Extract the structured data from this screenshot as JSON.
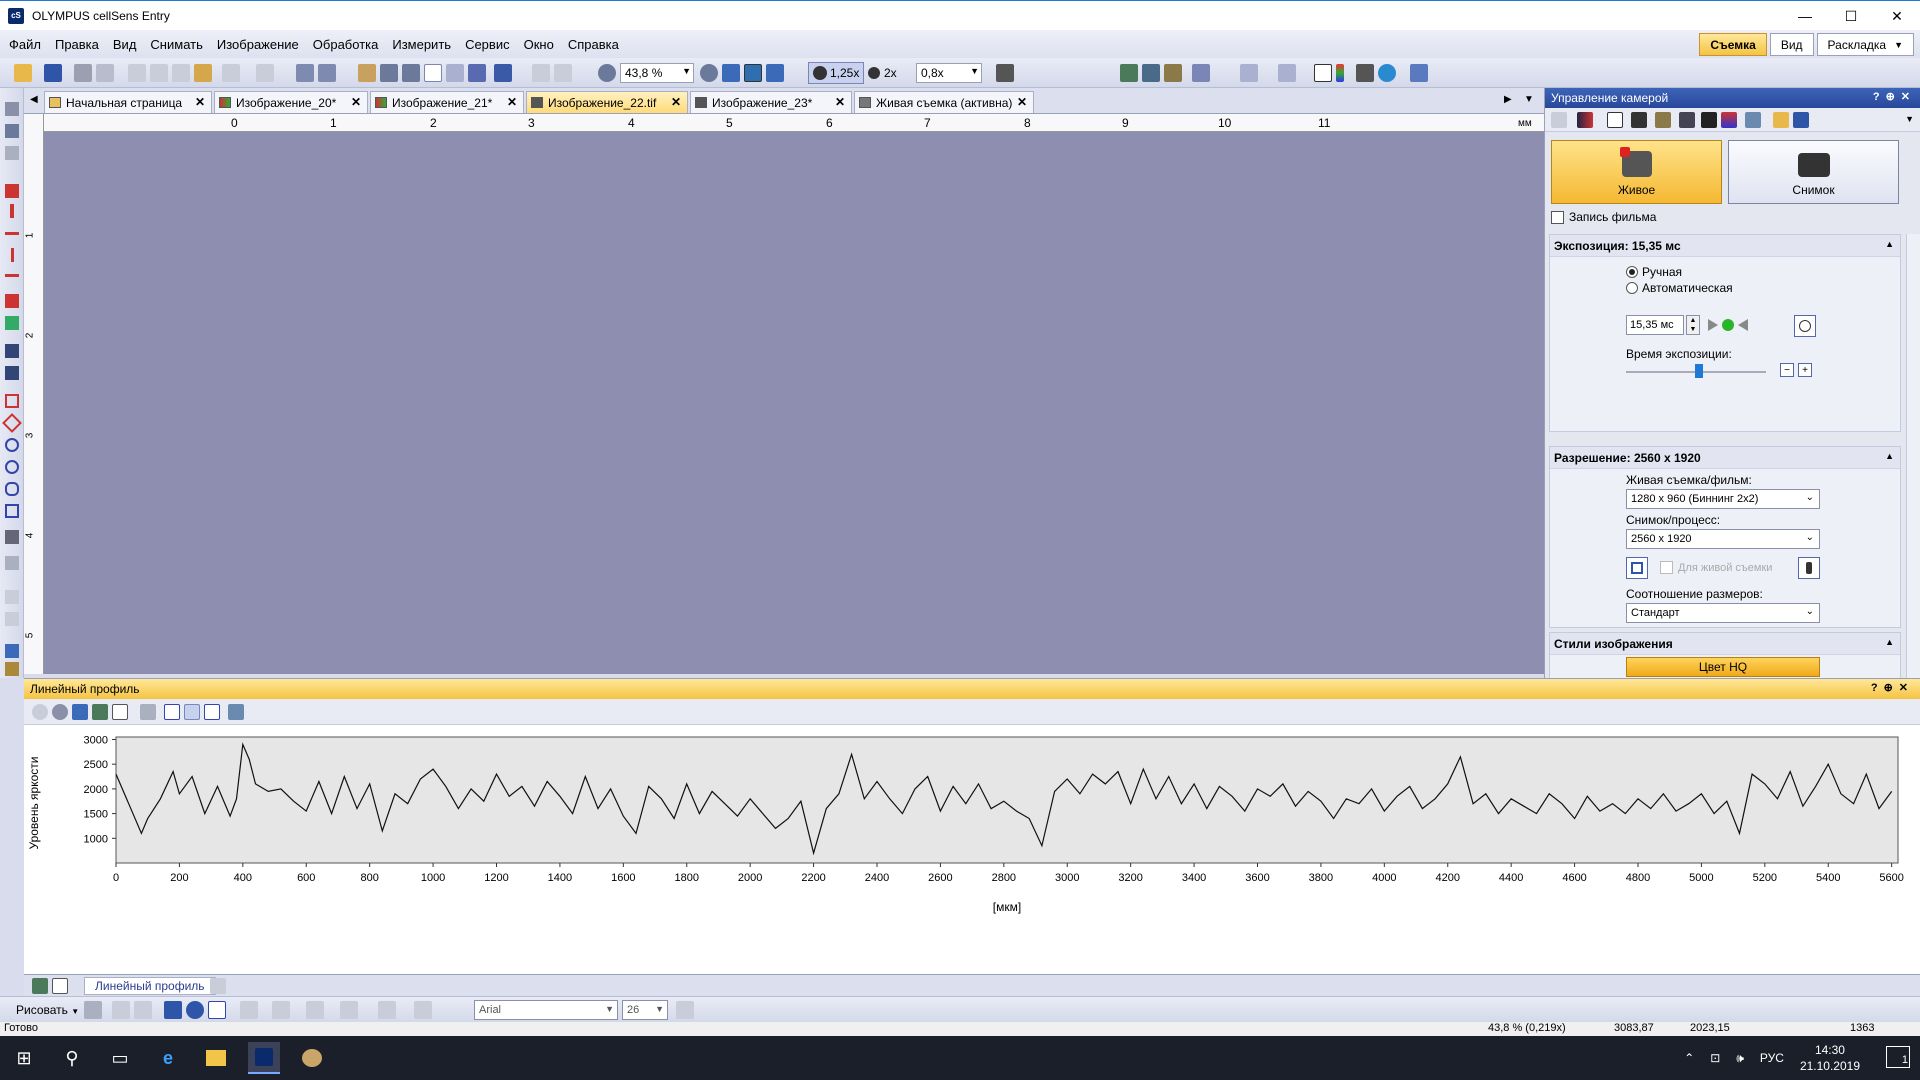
{
  "window": {
    "title": "OLYMPUS cellSens Entry",
    "app_icon": "cS",
    "minimize": "—",
    "maximize": "☐",
    "close": "✕"
  },
  "menu": {
    "items": [
      "Файл",
      "Правка",
      "Вид",
      "Снимать",
      "Изображение",
      "Обработка",
      "Измерить",
      "Сервис",
      "Окно",
      "Справка"
    ],
    "right": {
      "shoot": "Съемка",
      "view": "Вид",
      "layout": "Раскладка"
    }
  },
  "toolbar": {
    "zoom": "43,8 %",
    "zoom_125": "1,25x",
    "zoom_2x": "2x",
    "zoom_08": "0,8x"
  },
  "doc_tabs": [
    {
      "label": "Начальная страница",
      "close": "✕"
    },
    {
      "label": "Изображение_20*",
      "close": "✕"
    },
    {
      "label": "Изображение_21*",
      "close": "✕"
    },
    {
      "label": "Изображение_22.tif",
      "close": "✕"
    },
    {
      "label": "Изображение_23*",
      "close": "✕"
    },
    {
      "label": "Живая съемка (активна)",
      "close": "✕"
    }
  ],
  "ruler": {
    "unit": "мм",
    "marks": [
      "0",
      "1",
      "2",
      "3",
      "4",
      "5",
      "6",
      "7",
      "8",
      "9",
      "10",
      "11"
    ],
    "vmarks": [
      "1",
      "2",
      "3",
      "4",
      "5"
    ]
  },
  "camera_panel": {
    "title": "Управление камерой",
    "live_button": "Живое",
    "snap_button": "Снимок",
    "record_movie": "Запись фильма",
    "exposure": {
      "title": "Экспозиция: 15,35 мс",
      "manual": "Ручная",
      "auto": "Автоматическая",
      "value": "15,35 мс",
      "time_label": "Время экспозиции:",
      "slider_fraction": 0.52
    },
    "resolution": {
      "title": "Разрешение: 2560 x 1920",
      "live_label": "Живая съемка/фильм:",
      "live_value": "1280 x 960 (Биннинг 2x2)",
      "snap_label": "Снимок/процесс:",
      "snap_value": "2560 x 1920",
      "for_live": "Для живой съемки",
      "aspect_label": "Соотношение размеров:",
      "aspect_value": "Стандарт"
    },
    "styles": {
      "title": "Стили изображения",
      "color_hq": "Цвет HQ"
    }
  },
  "line_profile": {
    "title": "Линейный профиль",
    "ylabel": "Уровень яркости",
    "xlabel": "[мкм]"
  },
  "chart_data": {
    "type": "line",
    "xlabel": "[мкм]",
    "ylabel": "Уровень яркости",
    "xlim": [
      0,
      5620
    ],
    "ylim": [
      500,
      3050
    ],
    "xticks": [
      0,
      200,
      400,
      600,
      800,
      1000,
      1200,
      1400,
      1600,
      1800,
      2000,
      2200,
      2400,
      2600,
      2800,
      3000,
      3200,
      3400,
      3600,
      3800,
      4000,
      4200,
      4400,
      4600,
      4800,
      5000,
      5200,
      5400,
      5600
    ],
    "yticks": [
      1000,
      1500,
      2000,
      2500,
      3000
    ],
    "grid": false,
    "x": [
      0,
      40,
      80,
      100,
      140,
      180,
      200,
      240,
      280,
      320,
      360,
      380,
      400,
      420,
      440,
      480,
      520,
      560,
      600,
      640,
      680,
      720,
      760,
      800,
      840,
      880,
      920,
      960,
      1000,
      1040,
      1080,
      1120,
      1160,
      1200,
      1240,
      1280,
      1320,
      1360,
      1400,
      1440,
      1480,
      1520,
      1560,
      1600,
      1640,
      1680,
      1720,
      1760,
      1800,
      1840,
      1880,
      1920,
      1960,
      2000,
      2040,
      2080,
      2120,
      2160,
      2200,
      2240,
      2280,
      2320,
      2360,
      2400,
      2440,
      2480,
      2520,
      2560,
      2600,
      2640,
      2680,
      2720,
      2760,
      2800,
      2840,
      2880,
      2920,
      2960,
      3000,
      3040,
      3080,
      3120,
      3160,
      3200,
      3240,
      3280,
      3320,
      3360,
      3400,
      3440,
      3480,
      3520,
      3560,
      3600,
      3640,
      3680,
      3720,
      3760,
      3800,
      3840,
      3880,
      3920,
      3960,
      4000,
      4040,
      4080,
      4120,
      4160,
      4200,
      4240,
      4280,
      4320,
      4360,
      4400,
      4440,
      4480,
      4520,
      4560,
      4600,
      4640,
      4680,
      4720,
      4760,
      4800,
      4840,
      4880,
      4920,
      4960,
      5000,
      5040,
      5080,
      5120,
      5160,
      5200,
      5240,
      5280,
      5320,
      5360,
      5400,
      5440,
      5480,
      5520,
      5560,
      5600
    ],
    "y": [
      2300,
      1700,
      1100,
      1400,
      1800,
      2350,
      1900,
      2250,
      1500,
      2050,
      1450,
      1800,
      2900,
      2600,
      2100,
      1950,
      2000,
      1750,
      1550,
      2150,
      1500,
      2250,
      1600,
      2100,
      1150,
      1900,
      1700,
      2200,
      2400,
      2050,
      1600,
      2000,
      1750,
      2300,
      1850,
      2050,
      1650,
      2150,
      1850,
      1500,
      2250,
      1600,
      2000,
      1450,
      1100,
      2050,
      1800,
      1400,
      2100,
      1500,
      1950,
      1700,
      1450,
      1800,
      1500,
      1200,
      1400,
      1750,
      700,
      1600,
      1900,
      2700,
      1800,
      2150,
      1800,
      1500,
      2000,
      2250,
      1550,
      2050,
      1700,
      2100,
      1600,
      1750,
      1550,
      1400,
      850,
      1950,
      2200,
      1900,
      2300,
      2100,
      2350,
      1700,
      2400,
      1800,
      2250,
      1700,
      2100,
      1600,
      2050,
      1850,
      1550,
      2000,
      1850,
      2100,
      1650,
      1950,
      1750,
      1400,
      1800,
      1700,
      2000,
      1550,
      1850,
      2050,
      1600,
      1800,
      2100,
      2650,
      1700,
      1900,
      1500,
      1800,
      1650,
      1500,
      1900,
      1700,
      1400,
      1850,
      1550,
      1700,
      1500,
      1800,
      1600,
      1900,
      1550,
      1700,
      1900,
      1500,
      1750,
      1100,
      2300,
      2100,
      1800,
      2350,
      1650,
      2050,
      2500,
      1900,
      1700,
      2300,
      1600,
      1950
    ]
  },
  "bottom_tabs": {
    "active": "Линейный профиль"
  },
  "draw_toolbar": {
    "label": "Рисовать",
    "font": "Arial",
    "size": "26"
  },
  "status": {
    "left": "Готово",
    "zoom": "43,8 % (0,219х)",
    "x": "3083,87",
    "y": "2023,15",
    "r": "1363"
  },
  "taskbar": {
    "time": "14:30",
    "date": "21.10.2019",
    "lang": "РУС",
    "notifications": "1"
  }
}
